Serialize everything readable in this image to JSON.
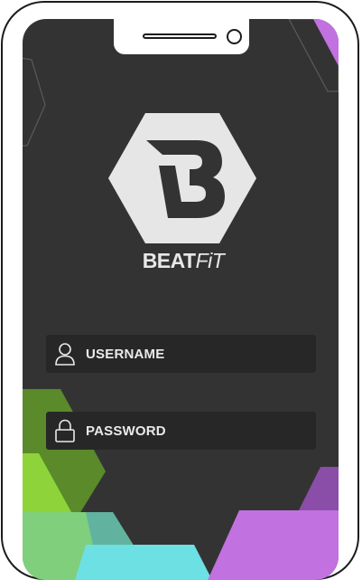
{
  "brand": {
    "name_bold": "BEAT",
    "name_light": "FiT"
  },
  "login": {
    "username_label": "USERNAME",
    "password_label": "PASSWORD"
  },
  "icons": {
    "username": "user-icon",
    "password": "lock-icon",
    "logo": "beatfit-hexagon-logo"
  },
  "colors": {
    "background": "#343333",
    "field_background": "#272727",
    "logo": "#e6e6e6",
    "accent_purple": "#c271e0",
    "accent_green": "#8ed33a",
    "accent_teal": "#6de0e3"
  }
}
